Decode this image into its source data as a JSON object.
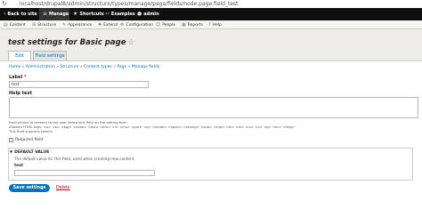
{
  "browser": {
    "url": "localhost/drupal8/admin/structure/types/manage/page/fields/node.page.field_test",
    "reload_icon": "reload-icon"
  },
  "toolbar": {
    "items": [
      {
        "label": "Back to site",
        "icon": "chevron-left-icon"
      },
      {
        "label": "Manage",
        "icon": "menu-icon"
      },
      {
        "label": "Shortcuts",
        "icon": "star-icon"
      },
      {
        "label": "Examples",
        "icon": "code-icon"
      },
      {
        "label": "admin",
        "icon": "user-icon"
      }
    ]
  },
  "tray": {
    "items": [
      {
        "label": "Content",
        "icon": "content-icon"
      },
      {
        "label": "Structure",
        "icon": "structure-icon"
      },
      {
        "label": "Appearance",
        "icon": "appearance-icon"
      },
      {
        "label": "Extend",
        "icon": "extend-icon"
      },
      {
        "label": "Configuration",
        "icon": "wrench-icon"
      },
      {
        "label": "People",
        "icon": "people-icon"
      },
      {
        "label": "Reports",
        "icon": "reports-icon"
      },
      {
        "label": "Help",
        "icon": "help-icon"
      }
    ]
  },
  "page": {
    "title_prefix": "test settings for ",
    "title_bundle": "Basic page",
    "star_glyph": "☆"
  },
  "tabs": [
    {
      "label": "Edit",
      "active": true
    },
    {
      "label": "Field settings",
      "active": false
    }
  ],
  "breadcrumb": [
    "Home",
    "Administration",
    "Structure",
    "Content types",
    "Page",
    "Manage fields"
  ],
  "breadcrumb_sep": " » ",
  "form": {
    "label_title": "Label",
    "label_required_mark": "*",
    "label_value": "test",
    "help_title": "Help text",
    "help_desc_1": "Instructions to present to the user below this field on the editing form.",
    "help_desc_2": "Allowed HTML tags: <a> <b> <big> <code> <del> <em> <i> <ins> <pre> <q> <small> <span> <strong> <sub> <sup> <tt> <ol> <ul> <li> <p> <br> <img>",
    "help_desc_3": "This field supports tokens.",
    "required_label": "Required field",
    "default_value_title": "DEFAULT VALUE",
    "default_value_desc": "The default value for this field, used when creating new content.",
    "default_field_label": "test",
    "save_label": "Save settings",
    "delete_label": "Delete"
  }
}
